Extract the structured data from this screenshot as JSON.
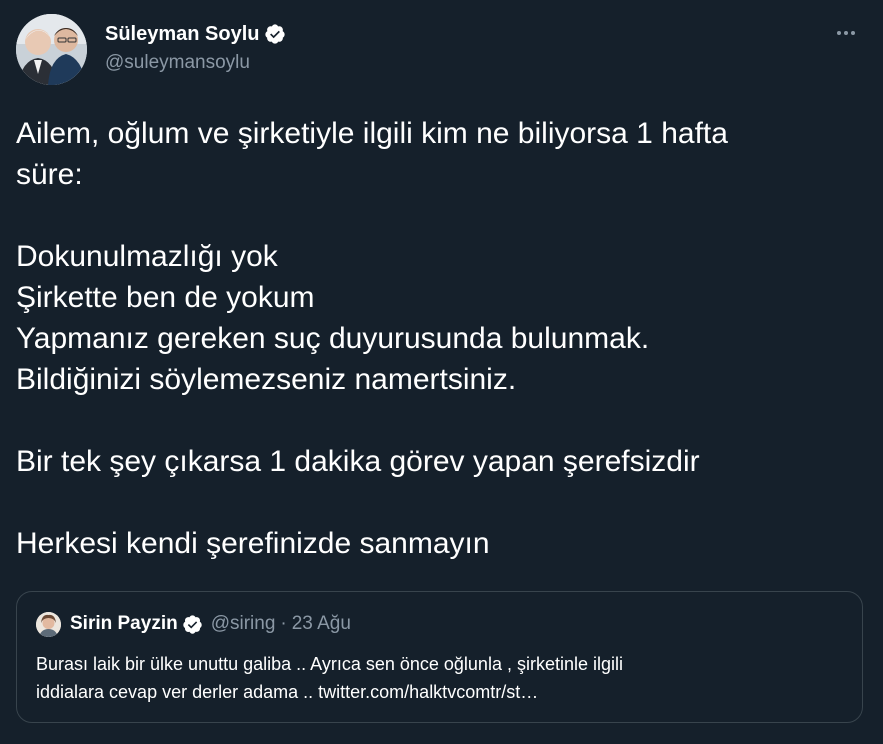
{
  "author": {
    "display_name": "Süleyman Soylu",
    "handle": "@suleymansoylu",
    "verified": true
  },
  "tweet": {
    "lines": [
      "Ailem, oğlum ve şirketiyle ilgili kim ne biliyorsa 1 hafta",
      "süre:",
      "",
      "Dokunulmazlığı yok",
      "Şirkette ben de yokum",
      "Yapmanız gereken suç duyurusunda bulunmak.",
      "Bildiğinizi söylemezseniz namertsiniz.",
      "",
      "Bir tek şey çıkarsa 1 dakika görev yapan şerefsizdir",
      "",
      "Herkesi kendi şerefinizde sanmayın"
    ]
  },
  "quoted_tweet": {
    "display_name": "Sirin Payzin",
    "handle": "@siring",
    "separator": "·",
    "date": "23 Ağu",
    "verified": true,
    "lines": [
      "Burası laik bir ülke unuttu galiba .. Ayrıca sen önce oğlunla , şirketinle ilgili",
      "iddialara cevap ver derler adama .. twitter.com/halktvcomtr/st…"
    ]
  },
  "icons": {
    "verified": "verified-badge-icon",
    "more": "more-horizontal-icon"
  },
  "colors": {
    "background": "#15202b",
    "text": "#ffffff",
    "secondary_text": "#8b98a5",
    "border": "#38444d"
  }
}
